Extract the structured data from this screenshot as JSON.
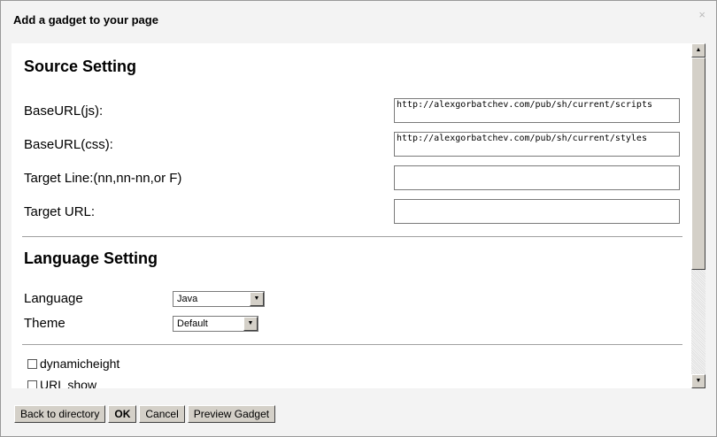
{
  "dialog": {
    "title": "Add a gadget to your page",
    "close": "×"
  },
  "source": {
    "heading": "Source Setting",
    "fields": [
      {
        "label": "BaseURL(js):",
        "value": "http://alexgorbatchev.com/pub/sh/current/scripts"
      },
      {
        "label": "BaseURL(css):",
        "value": "http://alexgorbatchev.com/pub/sh/current/styles"
      },
      {
        "label": "Target Line:(nn,nn-nn,or F)",
        "value": ""
      },
      {
        "label": "Target URL:",
        "value": ""
      }
    ]
  },
  "language": {
    "heading": "Language Setting",
    "language_label": "Language",
    "language_value": "Java",
    "theme_label": "Theme",
    "theme_value": "Default"
  },
  "options": [
    {
      "label": "dynamicheight",
      "checked": false
    },
    {
      "label": "URL show",
      "checked": false
    }
  ],
  "buttons": {
    "back": "Back to directory",
    "ok": "OK",
    "cancel": "Cancel",
    "preview": "Preview Gadget"
  }
}
